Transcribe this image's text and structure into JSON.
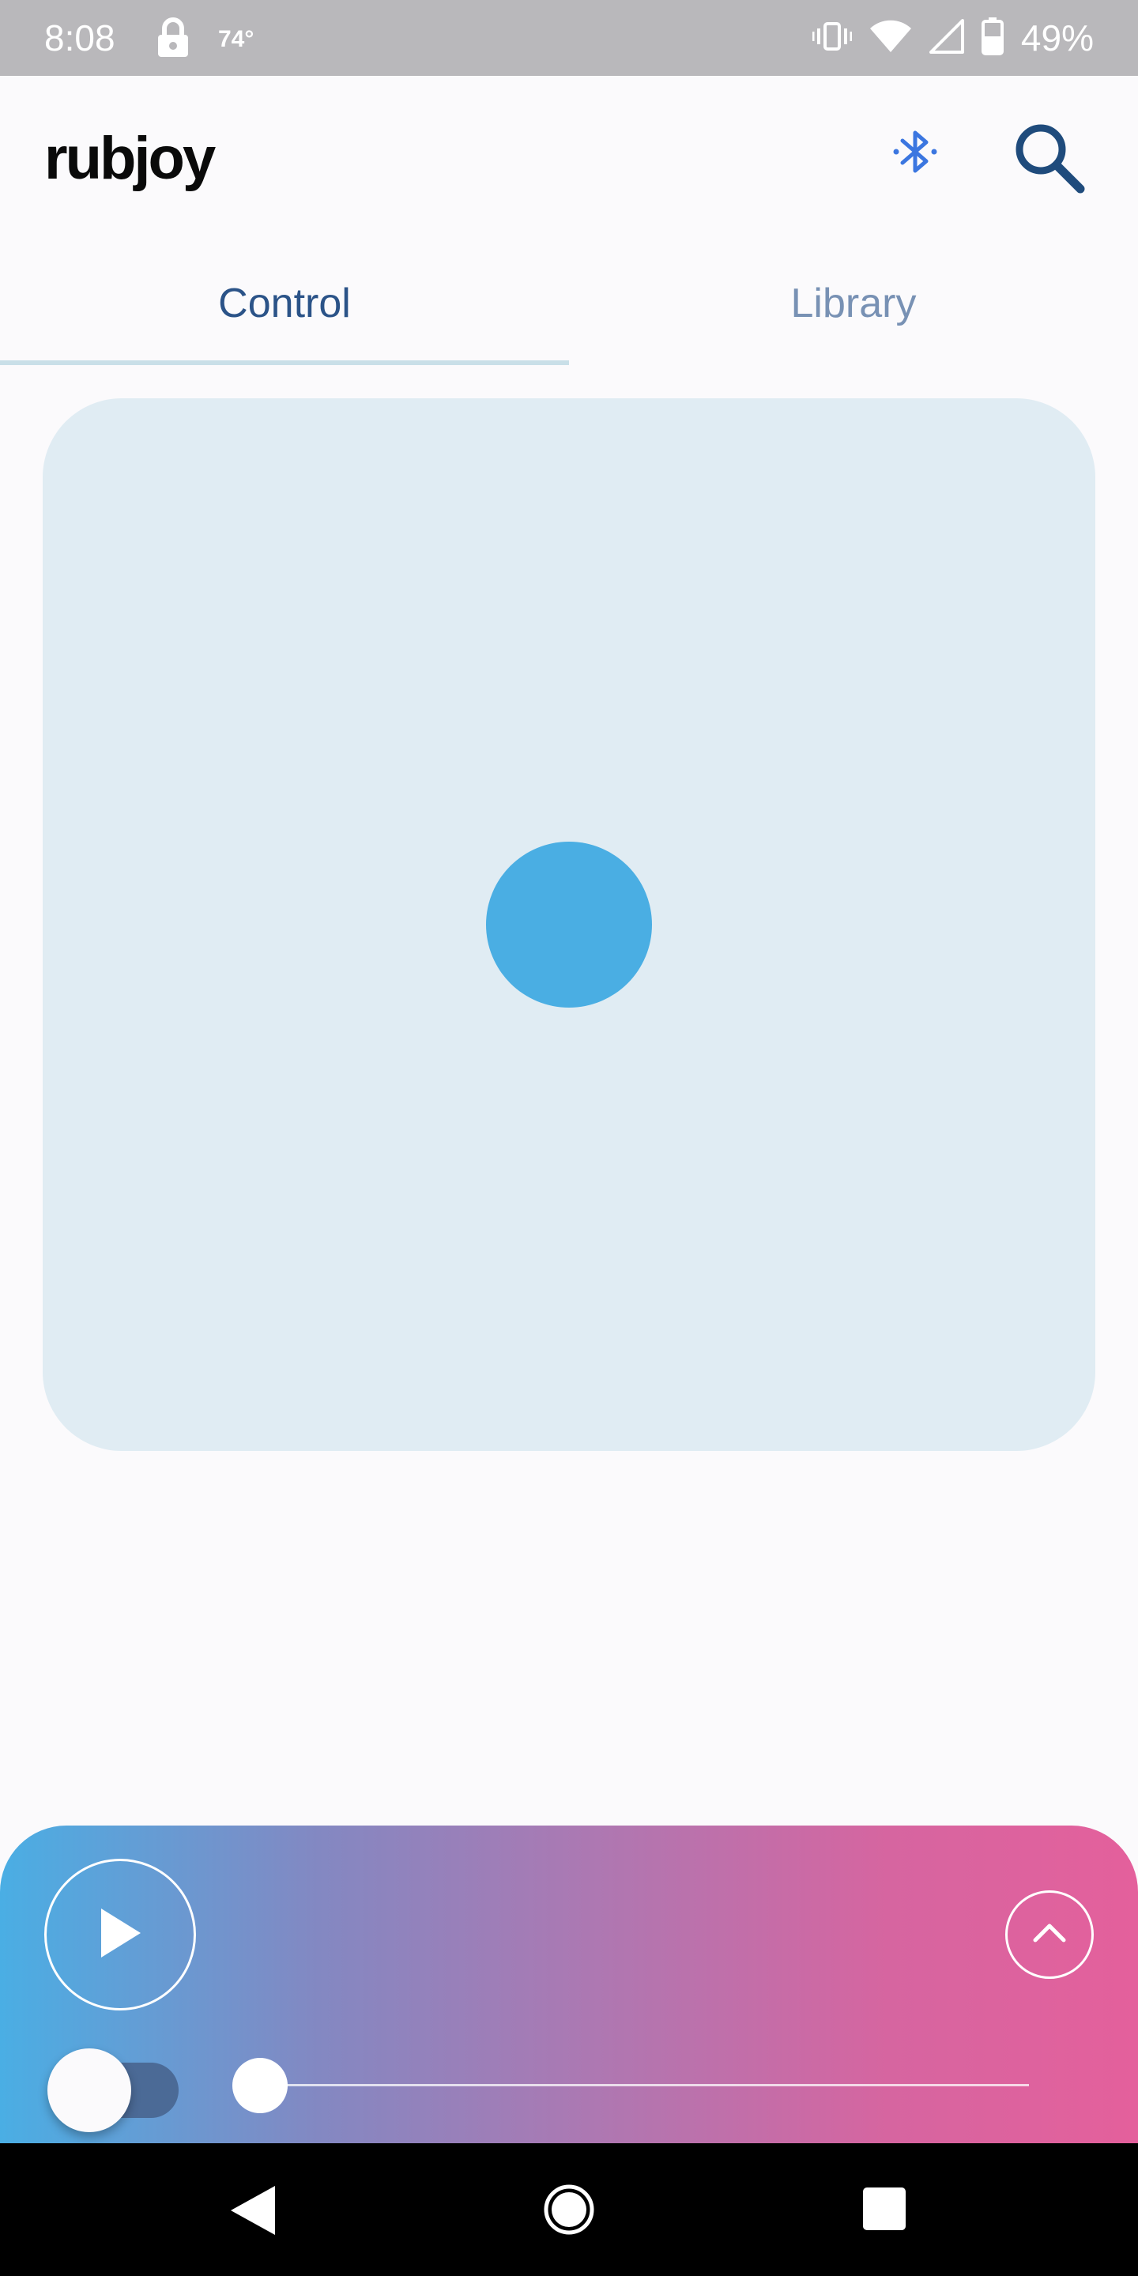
{
  "status_bar": {
    "time": "8:08",
    "temperature": "74°",
    "battery": "49%",
    "icons": [
      "lock-icon",
      "vibrate-icon",
      "wifi-icon",
      "signal-icon",
      "battery-icon"
    ]
  },
  "header": {
    "logo": "rubjoy",
    "icons": [
      "bluetooth-icon",
      "search-icon"
    ],
    "accent_color": "#3b76e0"
  },
  "tabs": [
    {
      "label": "Control",
      "active": true
    },
    {
      "label": "Library",
      "active": false
    }
  ],
  "control_pad": {
    "background_color": "#e0ecf3",
    "knob_color": "#4aaee3"
  },
  "player": {
    "play_icon": "play-icon",
    "expand_icon": "chevron-up-icon",
    "toggle_on": false,
    "progress": 0,
    "gradient_colors": [
      "#4aaee4",
      "#e4609c"
    ]
  },
  "nav": {
    "icons": [
      "back-icon",
      "home-icon",
      "recents-icon"
    ]
  }
}
